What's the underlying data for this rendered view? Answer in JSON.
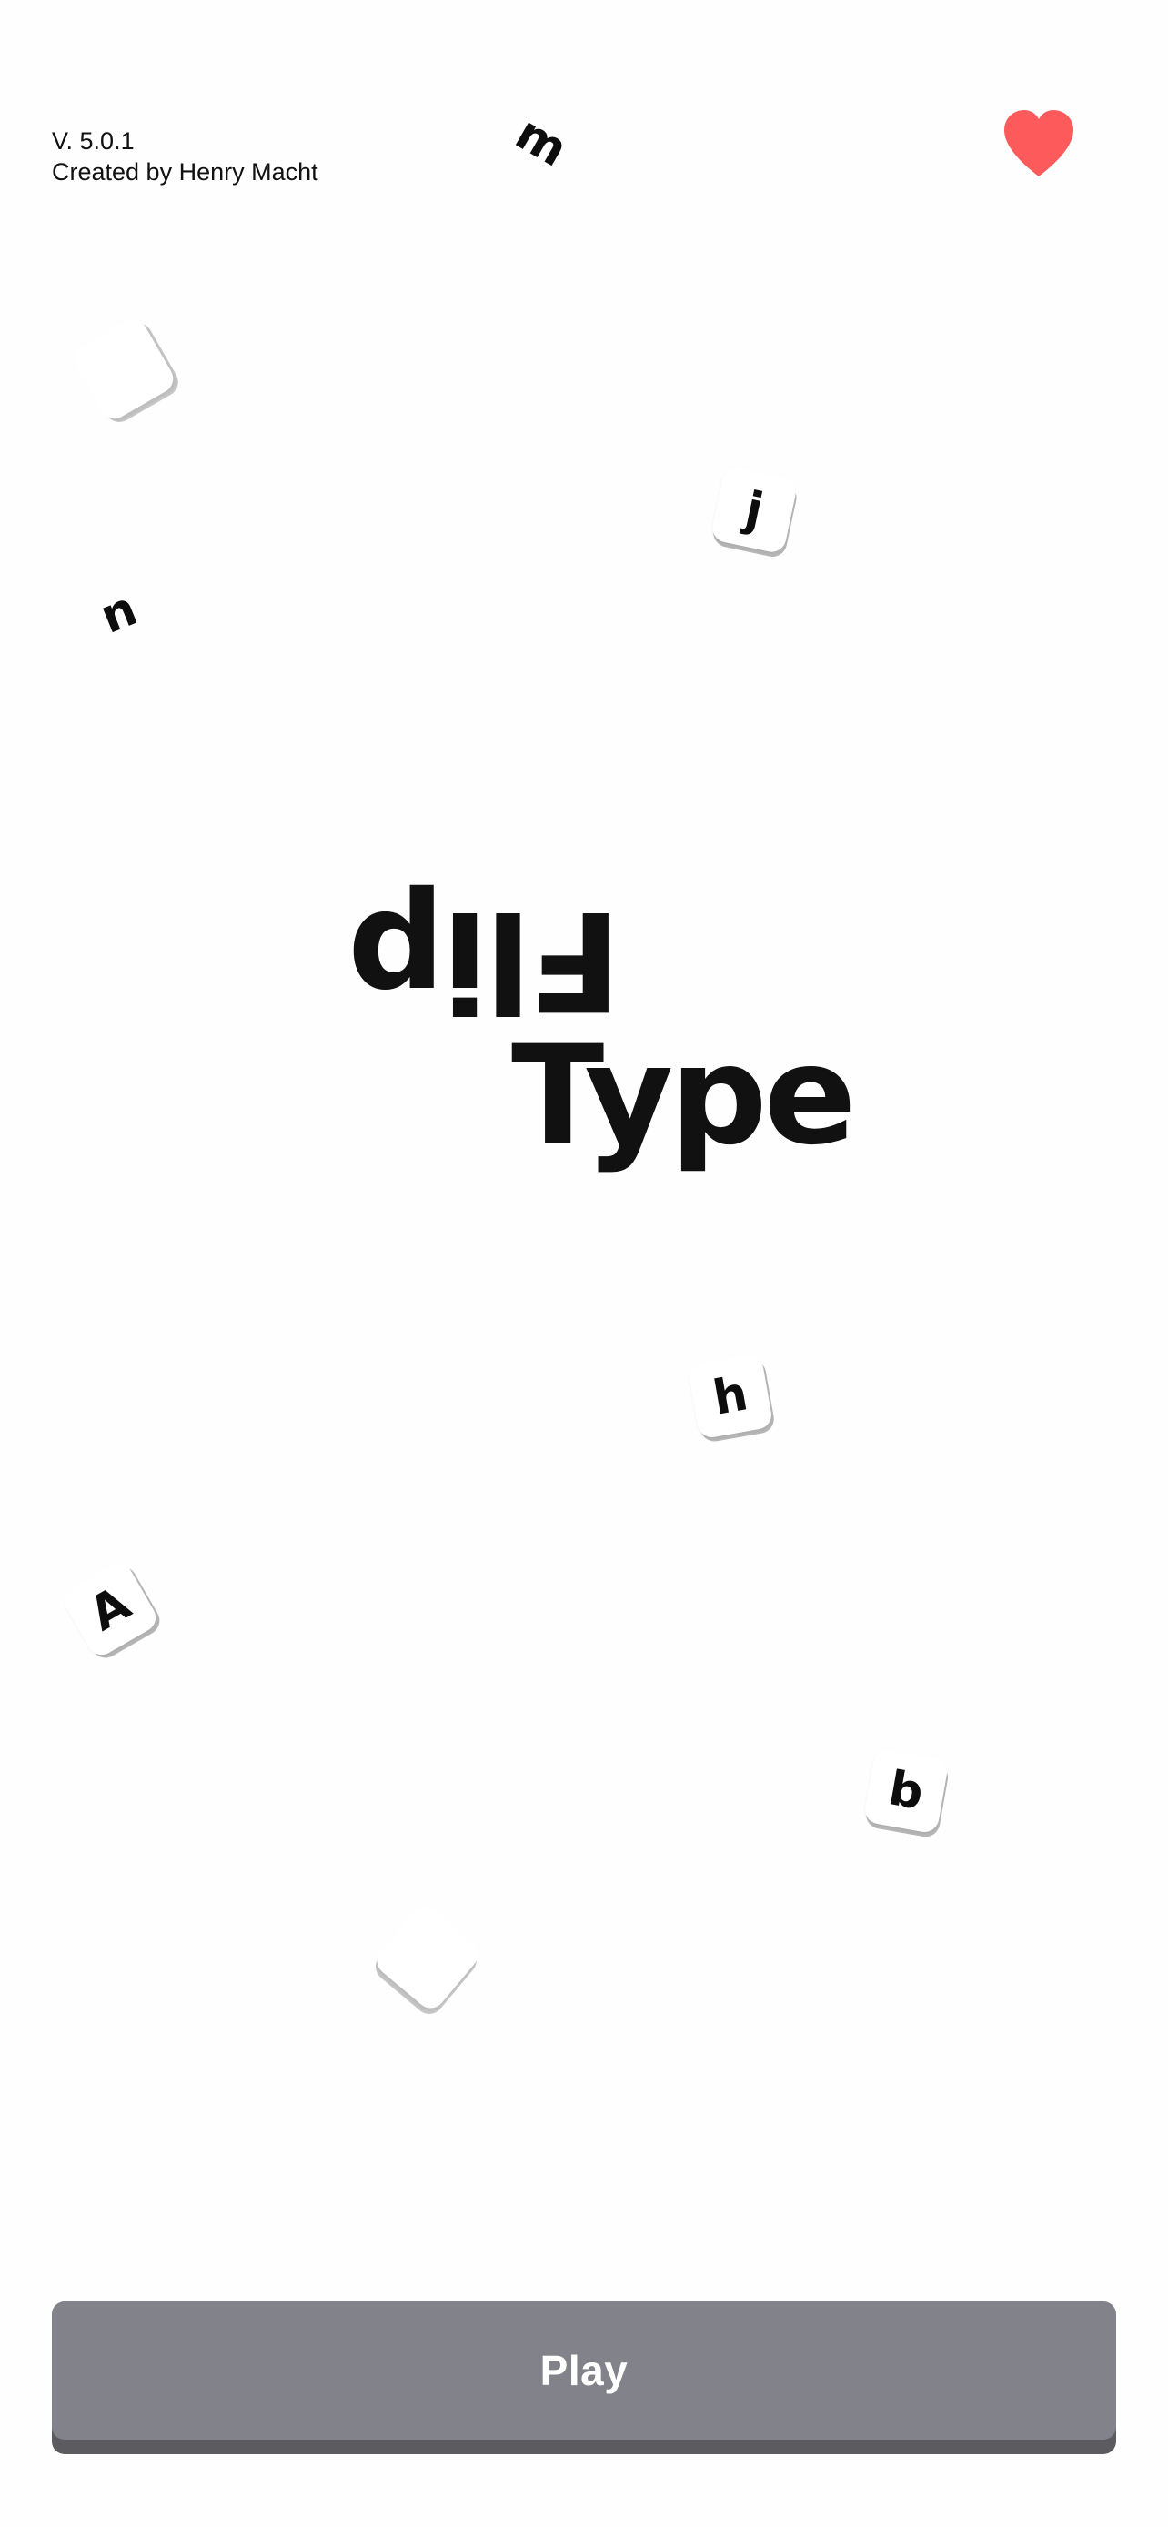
{
  "header": {
    "version": "V. 5.0.1",
    "credit": "Created by Henry Macht",
    "heart_icon": "heart-icon",
    "heart_color": "#fd5b5b"
  },
  "title": {
    "flipped_word": "Flip",
    "word": "Type"
  },
  "letters": {
    "m": "m",
    "n": "n",
    "j": "j",
    "h": "h",
    "a": "A",
    "b": "b"
  },
  "play_button": {
    "label": "Play",
    "color": "#82838a"
  }
}
